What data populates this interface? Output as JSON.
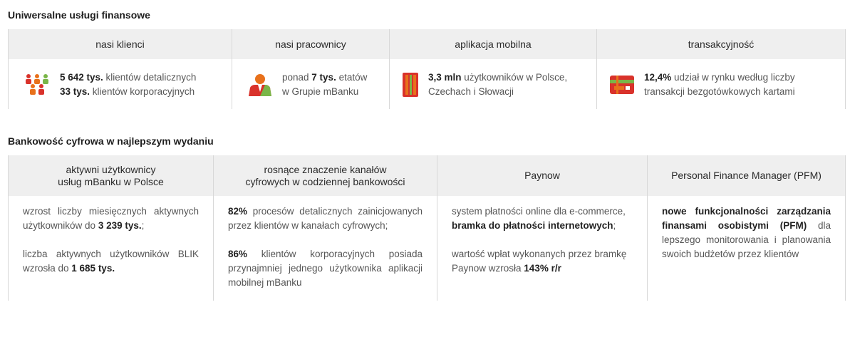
{
  "section1": {
    "title": "Uniwersalne usługi finansowe",
    "columns": [
      {
        "header": "nasi klienci",
        "icon": "people-group-icon",
        "line1_value": "5 642 tys.",
        "line1_text": " klientów detalicznych",
        "line2_value": "33 tys.",
        "line2_text": " klientów korporacyjnych"
      },
      {
        "header": "nasi pracownicy",
        "icon": "employee-icon",
        "line1_pre": "ponad ",
        "line1_value": "7 tys.",
        "line1_text": " etatów",
        "line2_text": "w Grupie mBanku"
      },
      {
        "header": "aplikacja mobilna",
        "icon": "mobile-app-icon",
        "line1_value": "3,3 mln",
        "line1_text": " użytkowników w Polsce,",
        "line2_text": "Czechach i Słowacji"
      },
      {
        "header": "transakcyjność",
        "icon": "payment-card-icon",
        "line1_value": "12,4%",
        "line1_text": " udział w rynku według liczby",
        "line2_text": "transakcji bezgotówkowych kartami"
      }
    ]
  },
  "section2": {
    "title": "Bankowość cyfrowa w najlepszym wydaniu",
    "columns": [
      {
        "header_l1": "aktywni użytkownicy",
        "header_l2": "usług mBanku w Polsce",
        "p1_text": "wzrost liczby miesięcznych aktywnych użytkowników do ",
        "p1_value": "3 239 tys.",
        "p1_tail": ";",
        "p2_text": "liczba aktywnych użytkowników BLIK wzrosła do ",
        "p2_value": "1 685 tys."
      },
      {
        "header_l1": "rosnące znaczenie kanałów",
        "header_l2": "cyfrowych w codziennej bankowości",
        "p1_value": "82%",
        "p1_text": " procesów detalicznych zainicjowanych przez klientów w kanałach cyfrowych;",
        "p2_value": "86%",
        "p2_text": " klientów korporacyjnych posiada przynajmniej jednego użytkownika aplikacji mobilnej mBanku"
      },
      {
        "header_l1": "Paynow",
        "p1_text": "system płatności online dla e-commerce, ",
        "p1_value": "bramka do płatności internetowych",
        "p1_tail": ";",
        "p2_text": "wartość wpłat wykonanych przez bramkę Paynow wzrosła ",
        "p2_value": "143% r/r"
      },
      {
        "header_l1": "Personal Finance Manager (PFM)",
        "p1_value": "nowe funkcjonalności zarządzania finansami osobistymi (PFM)",
        "p1_text": " dla lepszego monitorowania i planowania swoich budżetów przez klientów"
      }
    ]
  },
  "colors": {
    "orange": "#e8711c",
    "red": "#d9322b",
    "green": "#7ab648",
    "header_bg": "#efefef"
  }
}
